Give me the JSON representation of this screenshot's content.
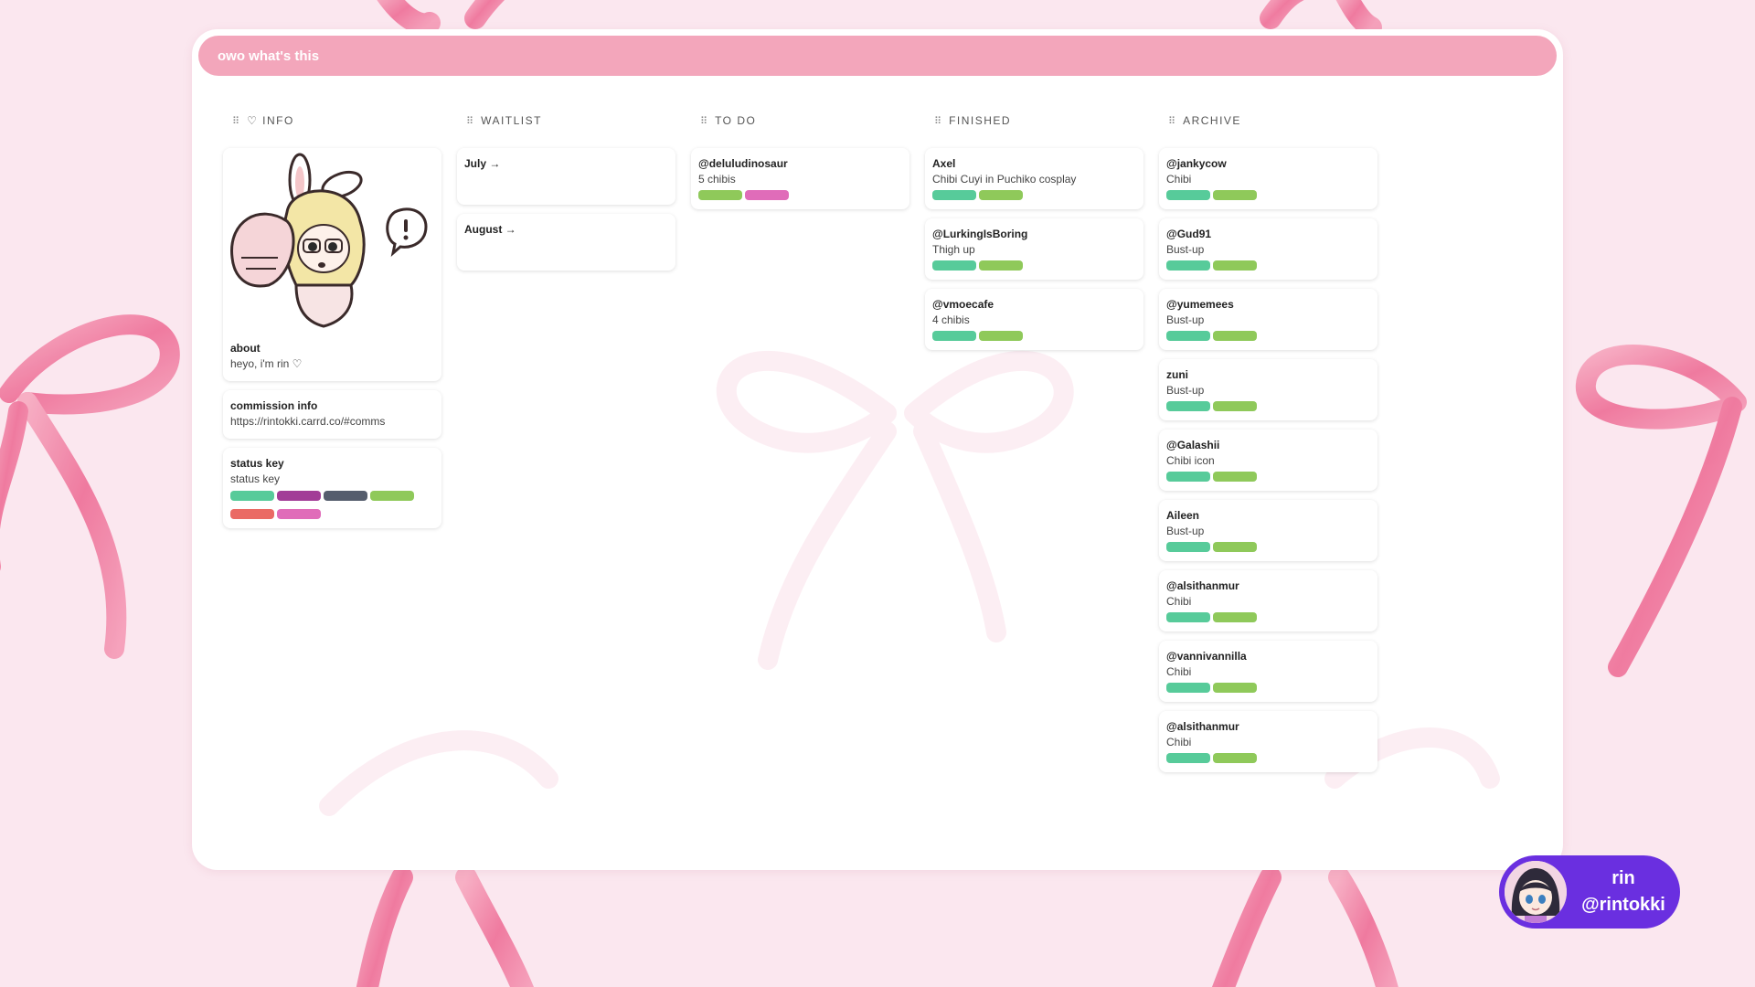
{
  "board": {
    "title": "owo what's this"
  },
  "colors": {
    "teal": "#57cb9a",
    "green": "#8fc95a",
    "purple": "#a23d97",
    "slate": "#555d6d",
    "red": "#ea6a64",
    "pink": "#e06cb9",
    "header": "#f3a6bb",
    "pill": "#6a2fe0"
  },
  "columns": [
    {
      "title": "♡ INFO",
      "cards": [
        {
          "title": "about",
          "subtitle": "heyo, i'm rin ♡",
          "image": true,
          "labels": []
        },
        {
          "title": "commission info",
          "subtitle": "https://rintokki.carrd.co/#comms",
          "labels": []
        },
        {
          "title": "status key",
          "subtitle": "status key",
          "labels": [
            "teal",
            "purple",
            "slate",
            "green",
            "red",
            "pink"
          ]
        }
      ]
    },
    {
      "title": "WAITLIST",
      "cards": [
        {
          "title": "July →",
          "subtitle": "",
          "labels": []
        },
        {
          "title": "August →",
          "subtitle": "",
          "labels": []
        }
      ]
    },
    {
      "title": "TO DO",
      "cards": [
        {
          "title": "@deluludinosaur",
          "subtitle": "5 chibis",
          "labels": [
            "green",
            "pink"
          ]
        }
      ]
    },
    {
      "title": "FINISHED",
      "cards": [
        {
          "title": "Axel",
          "subtitle": "Chibi Cuyi in Puchiko cosplay",
          "labels": [
            "teal",
            "green"
          ]
        },
        {
          "title": "@LurkingIsBoring",
          "subtitle": "Thigh up",
          "labels": [
            "teal",
            "green"
          ]
        },
        {
          "title": "@vmoecafe",
          "subtitle": "4 chibis",
          "labels": [
            "teal",
            "green"
          ]
        }
      ]
    },
    {
      "title": "ARCHIVE",
      "cards": [
        {
          "title": "@jankycow",
          "subtitle": "Chibi",
          "labels": [
            "teal",
            "green"
          ]
        },
        {
          "title": "@Gud91",
          "subtitle": "Bust-up",
          "labels": [
            "teal",
            "green"
          ]
        },
        {
          "title": "@yumemees",
          "subtitle": "Bust-up",
          "labels": [
            "teal",
            "green"
          ]
        },
        {
          "title": "zuni",
          "subtitle": "Bust-up",
          "labels": [
            "teal",
            "green"
          ]
        },
        {
          "title": "@Galashii",
          "subtitle": "Chibi icon",
          "labels": [
            "teal",
            "green"
          ]
        },
        {
          "title": "Aileen",
          "subtitle": "Bust-up",
          "labels": [
            "teal",
            "green"
          ]
        },
        {
          "title": "@alsithanmur",
          "subtitle": "Chibi",
          "labels": [
            "teal",
            "green"
          ]
        },
        {
          "title": "@vannivannilla",
          "subtitle": "Chibi",
          "labels": [
            "teal",
            "green"
          ]
        },
        {
          "title": "@alsithanmur",
          "subtitle": "Chibi",
          "labels": [
            "teal",
            "green"
          ]
        }
      ]
    }
  ],
  "profile": {
    "name": "rin",
    "handle": "@rintokki"
  },
  "icons": {
    "column_handle": "drag-handle-icon"
  }
}
